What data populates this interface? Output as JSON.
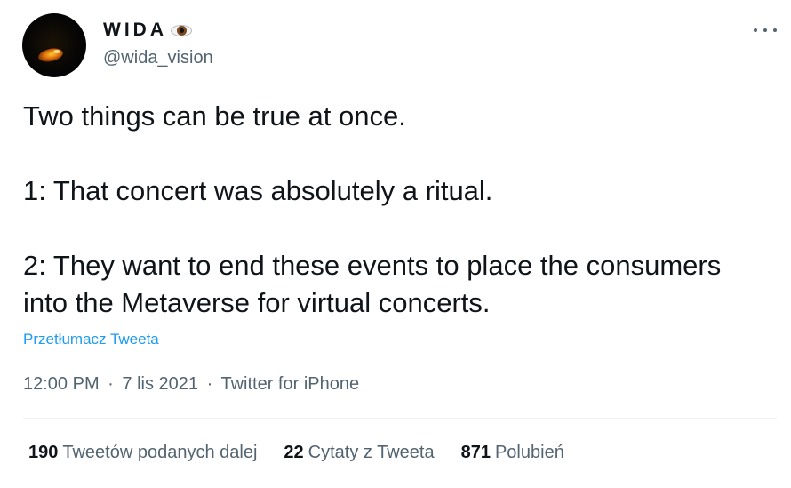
{
  "author": {
    "display_name": "WIDA",
    "display_name_emoji_icon": "eye-icon",
    "handle": "@wida_vision",
    "avatar_icon": "glowing-eye-avatar"
  },
  "more_icon": "more-horizontal-icon",
  "tweet": {
    "lines": [
      "Two things can be true at once.",
      "1: That concert was absolutely a ritual.",
      "2: They want to end these events to place the consumers into the Metaverse for virtual concerts."
    ],
    "translate_label": "Przetłumacz Tweeta",
    "time": "12:00 PM",
    "date": "7 lis 2021",
    "source": "Twitter for iPhone",
    "separator": "·"
  },
  "stats": {
    "retweets": {
      "count": "190",
      "label": "Tweetów podanych dalej"
    },
    "quotes": {
      "count": "22",
      "label": "Cytaty z Tweeta"
    },
    "likes": {
      "count": "871",
      "label": "Polubień"
    }
  },
  "colors": {
    "text": "#0f1419",
    "secondary": "#536471",
    "link": "#1d9bf0",
    "divider": "#eff3f4"
  }
}
